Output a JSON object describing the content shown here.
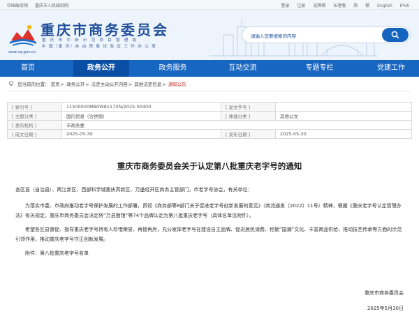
{
  "topbar": {
    "left_links": [
      "中国政府网",
      "重庆市人民政府网"
    ],
    "right_links": [
      "登录",
      "注册",
      "无障碍",
      "长者版",
      "简",
      "繁",
      "English",
      "IPV6"
    ]
  },
  "header": {
    "title": "重庆市商务委员会",
    "subtitle_line1": "重 庆 市 中 新 示 范 项 目 管 理 局",
    "subtitle_line2": "中 国（重 庆）自 由 贸 易 试 验 区 工 作 办 公 室",
    "domain": "sww.cq.gov.cn",
    "search_placeholder": "请输入您要搜索的内容"
  },
  "nav": {
    "items": [
      "首页",
      "政务公开",
      "政务服务",
      "互动交流",
      "专题专栏",
      "党建工作"
    ],
    "active_index": 1
  },
  "breadcrumb": {
    "prefix": "您当前的位置：",
    "items": [
      "首页",
      "政务公开",
      "法定主动公开内容",
      "其他法定信息"
    ],
    "current": "通知公告"
  },
  "meta": {
    "index_label": "[ 索引号 ]",
    "index_value": "11500000MB0W8117XN/2025-00400",
    "doc_no_label": "[ 发文字号 ]",
    "doc_no_value": "",
    "topic_label": "[ 主题分类 ]",
    "topic_value": "国内贸易（含供销）",
    "genre_label": "[ 体裁分类 ]",
    "genre_value": "其他公文",
    "org_label": "[ 发布机构 ]",
    "org_value": "市商务委",
    "created_label": "[ 成文日期 ]",
    "created_value": "2025-05-30",
    "published_label": "[ 发布日期 ]",
    "published_value": "2025-05-30"
  },
  "article": {
    "title": "重庆市商务委员会关于认定第八批重庆老字号的通知",
    "salutation": "各区县（自治县）、两江新区、西部科学城重庆高新区、万盛经开区商务主管部门，市老字号协会，有关单位：",
    "para1": "为落实市委、市政府推动老字号保护发展的工作部署，贯彻《商务部等8部门关于促进老字号创新发展的意见》（商流通发〔2022〕11号）精神，根据《重庆老字号认定管理办法》有关规定，重庆市商务委员会决定将“万县面馆”等74个品牌认定为第八批重庆老字号（具体名单见附件）。",
    "para2": "希望各区县督促、指导重庆老字号持有人珍惜荣誉，再接再厉，充分发挥老字号在建设自主品牌、促进居民消费、挖掘“国潮”文化、丰富商品供给、推动技艺传承等方面的示范引领作用，推动重庆老字号守正创新发展。",
    "attachment": "附件：第八批重庆老字号名单",
    "signature": "重庆市商务委员会",
    "date": "2025年5月30日"
  },
  "colors": {
    "brand": "#1f4e9b",
    "nav_bg": "#1766c2",
    "nav_active": "#0b4ea5",
    "breadcrumb_current": "#c62828"
  }
}
